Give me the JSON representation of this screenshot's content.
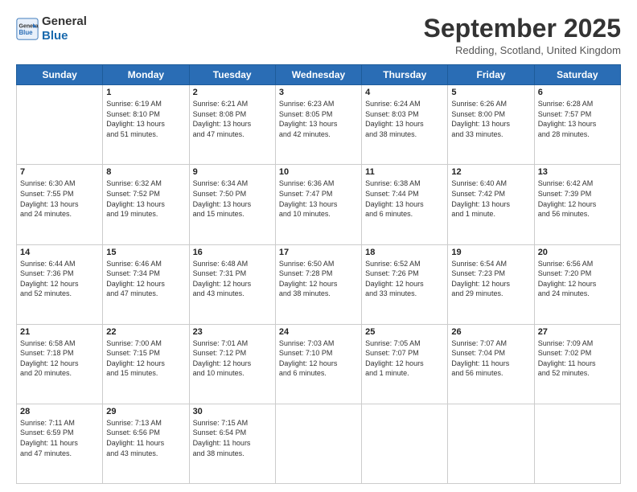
{
  "header": {
    "logo_line1": "General",
    "logo_line2": "Blue",
    "month": "September 2025",
    "location": "Redding, Scotland, United Kingdom"
  },
  "days_of_week": [
    "Sunday",
    "Monday",
    "Tuesday",
    "Wednesday",
    "Thursday",
    "Friday",
    "Saturday"
  ],
  "weeks": [
    [
      {
        "day": "",
        "text": ""
      },
      {
        "day": "1",
        "text": "Sunrise: 6:19 AM\nSunset: 8:10 PM\nDaylight: 13 hours\nand 51 minutes."
      },
      {
        "day": "2",
        "text": "Sunrise: 6:21 AM\nSunset: 8:08 PM\nDaylight: 13 hours\nand 47 minutes."
      },
      {
        "day": "3",
        "text": "Sunrise: 6:23 AM\nSunset: 8:05 PM\nDaylight: 13 hours\nand 42 minutes."
      },
      {
        "day": "4",
        "text": "Sunrise: 6:24 AM\nSunset: 8:03 PM\nDaylight: 13 hours\nand 38 minutes."
      },
      {
        "day": "5",
        "text": "Sunrise: 6:26 AM\nSunset: 8:00 PM\nDaylight: 13 hours\nand 33 minutes."
      },
      {
        "day": "6",
        "text": "Sunrise: 6:28 AM\nSunset: 7:57 PM\nDaylight: 13 hours\nand 28 minutes."
      }
    ],
    [
      {
        "day": "7",
        "text": "Sunrise: 6:30 AM\nSunset: 7:55 PM\nDaylight: 13 hours\nand 24 minutes."
      },
      {
        "day": "8",
        "text": "Sunrise: 6:32 AM\nSunset: 7:52 PM\nDaylight: 13 hours\nand 19 minutes."
      },
      {
        "day": "9",
        "text": "Sunrise: 6:34 AM\nSunset: 7:50 PM\nDaylight: 13 hours\nand 15 minutes."
      },
      {
        "day": "10",
        "text": "Sunrise: 6:36 AM\nSunset: 7:47 PM\nDaylight: 13 hours\nand 10 minutes."
      },
      {
        "day": "11",
        "text": "Sunrise: 6:38 AM\nSunset: 7:44 PM\nDaylight: 13 hours\nand 6 minutes."
      },
      {
        "day": "12",
        "text": "Sunrise: 6:40 AM\nSunset: 7:42 PM\nDaylight: 13 hours\nand 1 minute."
      },
      {
        "day": "13",
        "text": "Sunrise: 6:42 AM\nSunset: 7:39 PM\nDaylight: 12 hours\nand 56 minutes."
      }
    ],
    [
      {
        "day": "14",
        "text": "Sunrise: 6:44 AM\nSunset: 7:36 PM\nDaylight: 12 hours\nand 52 minutes."
      },
      {
        "day": "15",
        "text": "Sunrise: 6:46 AM\nSunset: 7:34 PM\nDaylight: 12 hours\nand 47 minutes."
      },
      {
        "day": "16",
        "text": "Sunrise: 6:48 AM\nSunset: 7:31 PM\nDaylight: 12 hours\nand 43 minutes."
      },
      {
        "day": "17",
        "text": "Sunrise: 6:50 AM\nSunset: 7:28 PM\nDaylight: 12 hours\nand 38 minutes."
      },
      {
        "day": "18",
        "text": "Sunrise: 6:52 AM\nSunset: 7:26 PM\nDaylight: 12 hours\nand 33 minutes."
      },
      {
        "day": "19",
        "text": "Sunrise: 6:54 AM\nSunset: 7:23 PM\nDaylight: 12 hours\nand 29 minutes."
      },
      {
        "day": "20",
        "text": "Sunrise: 6:56 AM\nSunset: 7:20 PM\nDaylight: 12 hours\nand 24 minutes."
      }
    ],
    [
      {
        "day": "21",
        "text": "Sunrise: 6:58 AM\nSunset: 7:18 PM\nDaylight: 12 hours\nand 20 minutes."
      },
      {
        "day": "22",
        "text": "Sunrise: 7:00 AM\nSunset: 7:15 PM\nDaylight: 12 hours\nand 15 minutes."
      },
      {
        "day": "23",
        "text": "Sunrise: 7:01 AM\nSunset: 7:12 PM\nDaylight: 12 hours\nand 10 minutes."
      },
      {
        "day": "24",
        "text": "Sunrise: 7:03 AM\nSunset: 7:10 PM\nDaylight: 12 hours\nand 6 minutes."
      },
      {
        "day": "25",
        "text": "Sunrise: 7:05 AM\nSunset: 7:07 PM\nDaylight: 12 hours\nand 1 minute."
      },
      {
        "day": "26",
        "text": "Sunrise: 7:07 AM\nSunset: 7:04 PM\nDaylight: 11 hours\nand 56 minutes."
      },
      {
        "day": "27",
        "text": "Sunrise: 7:09 AM\nSunset: 7:02 PM\nDaylight: 11 hours\nand 52 minutes."
      }
    ],
    [
      {
        "day": "28",
        "text": "Sunrise: 7:11 AM\nSunset: 6:59 PM\nDaylight: 11 hours\nand 47 minutes."
      },
      {
        "day": "29",
        "text": "Sunrise: 7:13 AM\nSunset: 6:56 PM\nDaylight: 11 hours\nand 43 minutes."
      },
      {
        "day": "30",
        "text": "Sunrise: 7:15 AM\nSunset: 6:54 PM\nDaylight: 11 hours\nand 38 minutes."
      },
      {
        "day": "",
        "text": ""
      },
      {
        "day": "",
        "text": ""
      },
      {
        "day": "",
        "text": ""
      },
      {
        "day": "",
        "text": ""
      }
    ]
  ]
}
